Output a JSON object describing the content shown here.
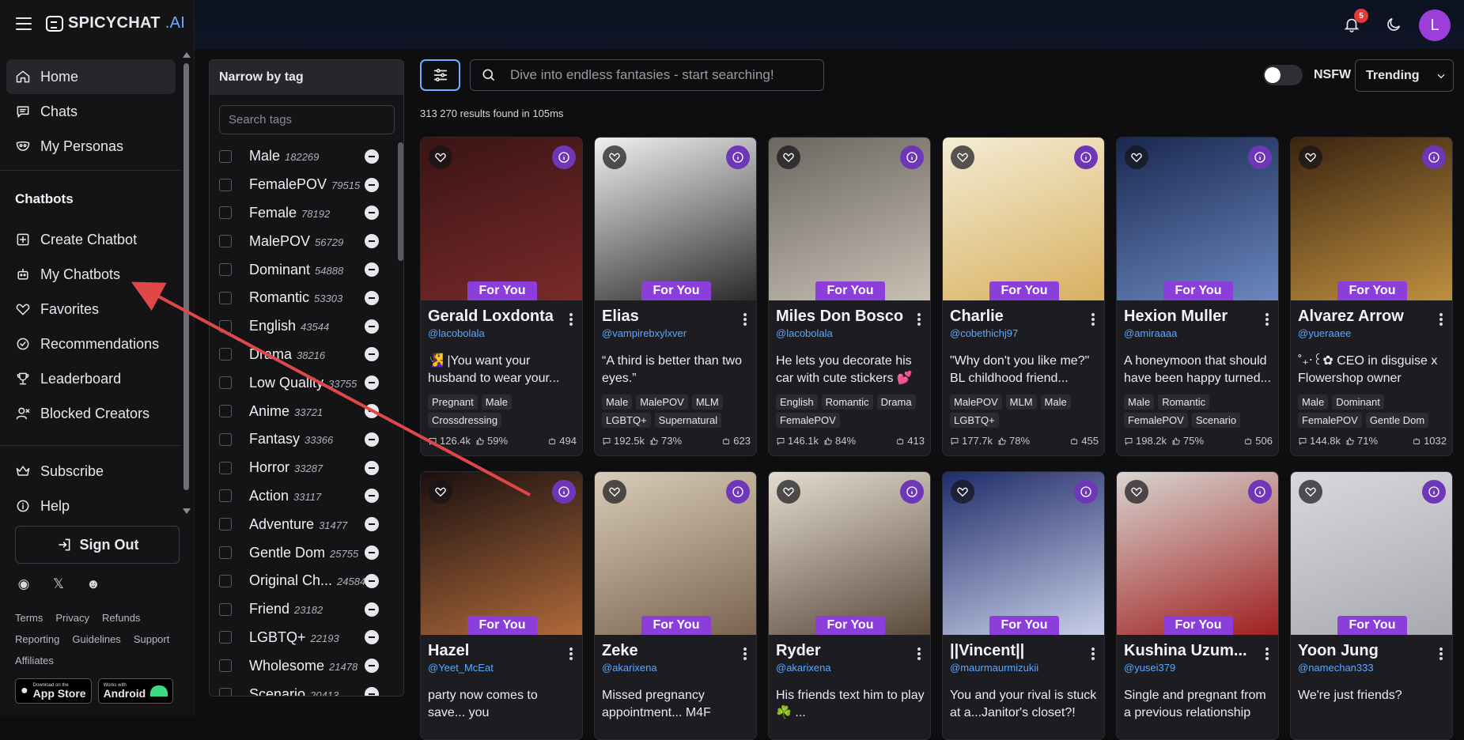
{
  "logo": {
    "main": "SPICYCHAT",
    "suffix": ".AI"
  },
  "nav": [
    {
      "label": "Home",
      "icon": "home-icon"
    },
    {
      "label": "Chats",
      "icon": "chat-icon"
    },
    {
      "label": "My Personas",
      "icon": "mask-icon"
    }
  ],
  "chatbots_section": "Chatbots",
  "chatbot_nav": [
    {
      "label": "Create Chatbot",
      "icon": "plus-square-icon"
    },
    {
      "label": "My Chatbots",
      "icon": "bot-icon"
    },
    {
      "label": "Favorites",
      "icon": "heart-icon"
    },
    {
      "label": "Recommendations",
      "icon": "check-circle-icon"
    },
    {
      "label": "Leaderboard",
      "icon": "trophy-icon"
    },
    {
      "label": "Blocked Creators",
      "icon": "user-x-icon"
    }
  ],
  "bottom_nav": [
    {
      "label": "Subscribe",
      "icon": "crown-icon"
    },
    {
      "label": "Help",
      "icon": "info-icon"
    }
  ],
  "sign_out": "Sign Out",
  "footer_links": [
    "Terms",
    "Privacy",
    "Refunds",
    "Reporting",
    "Guidelines",
    "Support",
    "Affiliates"
  ],
  "stores": {
    "apple_small": "Download on the",
    "apple_big": "App Store",
    "android_small": "Works with",
    "android_big": "Android"
  },
  "tag_panel": {
    "title": "Narrow by tag",
    "search_placeholder": "Search tags",
    "tags": [
      {
        "name": "Male",
        "count": "182269"
      },
      {
        "name": "FemalePOV",
        "count": "79515"
      },
      {
        "name": "Female",
        "count": "78192"
      },
      {
        "name": "MalePOV",
        "count": "56729"
      },
      {
        "name": "Dominant",
        "count": "54888"
      },
      {
        "name": "Romantic",
        "count": "53303"
      },
      {
        "name": "English",
        "count": "43544"
      },
      {
        "name": "Drama",
        "count": "38216"
      },
      {
        "name": "Low Quality",
        "count": "33755"
      },
      {
        "name": "Anime",
        "count": "33721"
      },
      {
        "name": "Fantasy",
        "count": "33366"
      },
      {
        "name": "Horror",
        "count": "33287"
      },
      {
        "name": "Action",
        "count": "33117"
      },
      {
        "name": "Adventure",
        "count": "31477"
      },
      {
        "name": "Gentle Dom",
        "count": "25755"
      },
      {
        "name": "Original Ch...",
        "count": "24584"
      },
      {
        "name": "Friend",
        "count": "23182"
      },
      {
        "name": "LGBTQ+",
        "count": "22193"
      },
      {
        "name": "Wholesome",
        "count": "21478"
      },
      {
        "name": "Scenario",
        "count": "20413"
      }
    ]
  },
  "search": {
    "placeholder": "Dive into endless fantasies - start searching!"
  },
  "results_text": "313 270 results found in 105ms",
  "nsfw_label": "NSFW",
  "sort": {
    "selected": "Trending"
  },
  "notifications": {
    "count": "5"
  },
  "user": {
    "initial": "L"
  },
  "for_you_label": "For You",
  "cards": [
    {
      "name": "Gerald Loxdonta",
      "creator": "@lacobolala",
      "desc": "🧏‍♀️ |You want your husband to wear your...",
      "tags": [
        "Pregnant",
        "Male",
        "Crossdressing"
      ],
      "chats": "126.4k",
      "likes": "59%",
      "bots": "494",
      "bg": [
        "#3a1414",
        "#7a2a2a"
      ]
    },
    {
      "name": "Elias",
      "creator": "@vampirebxylxver",
      "desc": "“A third is better than two eyes.”",
      "tags": [
        "Male",
        "MalePOV",
        "MLM",
        "LGBTQ+",
        "Supernatural"
      ],
      "chats": "192.5k",
      "likes": "73%",
      "bots": "623",
      "bg": [
        "#f0f0f0",
        "#2a2a2a"
      ]
    },
    {
      "name": "Miles Don Bosco",
      "creator": "@lacobolala",
      "desc": "He lets you decorate his car with cute stickers 💕",
      "tags": [
        "English",
        "Romantic",
        "Drama",
        "FemalePOV"
      ],
      "chats": "146.1k",
      "likes": "84%",
      "bots": "413",
      "bg": [
        "#6a6660",
        "#c8c0b4"
      ]
    },
    {
      "name": "Charlie",
      "creator": "@cobethichj97",
      "desc": "\"Why don't you like me?\" BL childhood friend...",
      "tags": [
        "MalePOV",
        "MLM",
        "Male",
        "LGBTQ+"
      ],
      "chats": "177.7k",
      "likes": "78%",
      "bots": "455",
      "bg": [
        "#f4ecd4",
        "#d8b060"
      ]
    },
    {
      "name": "Hexion Muller",
      "creator": "@amiraaaa",
      "desc": "A honeymoon that should have been happy turned...",
      "tags": [
        "Male",
        "Romantic",
        "FemalePOV",
        "Scenario"
      ],
      "chats": "198.2k",
      "likes": "75%",
      "bots": "506",
      "bg": [
        "#1a2850",
        "#6a88c0"
      ]
    },
    {
      "name": "Alvarez Arrow",
      "creator": "@yueraaee",
      "desc": "˚₊‧꒰✿ CEO in disguise x Flowershop owner",
      "tags": [
        "Male",
        "Dominant",
        "FemalePOV",
        "Gentle Dom"
      ],
      "chats": "144.8k",
      "likes": "71%",
      "bots": "1032",
      "bg": [
        "#3a2410",
        "#c09040"
      ]
    },
    {
      "name": "Hazel",
      "creator": "@Yeet_McEat",
      "desc": "party now comes to save... you",
      "tags": [],
      "chats": "",
      "likes": "",
      "bots": "",
      "bg": [
        "#1a1010",
        "#b06a3a"
      ]
    },
    {
      "name": "Zeke",
      "creator": "@akarixena",
      "desc": "Missed pregnancy appointment... M4F",
      "tags": [],
      "chats": "",
      "likes": "",
      "bots": "",
      "bg": [
        "#d8ccb8",
        "#7a6450"
      ]
    },
    {
      "name": "Ryder",
      "creator": "@akarixena",
      "desc": "His friends text him to play ☘️ ...",
      "tags": [],
      "chats": "",
      "likes": "",
      "bots": "",
      "bg": [
        "#e4dcd0",
        "#5a4a3c"
      ]
    },
    {
      "name": "||Vincent||",
      "creator": "@maurmaurmizukii",
      "desc": "You and your rival is stuck at a...Janitor's closet?!",
      "tags": [],
      "chats": "",
      "likes": "",
      "bots": "",
      "bg": [
        "#202c6a",
        "#c8d0e8"
      ]
    },
    {
      "name": "Kushina Uzum...",
      "creator": "@yusei379",
      "desc": "Single and pregnant from a previous relationship",
      "tags": [],
      "chats": "",
      "likes": "",
      "bots": "",
      "bg": [
        "#d8d4d0",
        "#a02020"
      ]
    },
    {
      "name": "Yoon Jung",
      "creator": "@namechan333",
      "desc": "We're just friends?",
      "tags": [],
      "chats": "",
      "likes": "",
      "bots": "",
      "bg": [
        "#d8d8dc",
        "#a8a8b0"
      ]
    }
  ]
}
